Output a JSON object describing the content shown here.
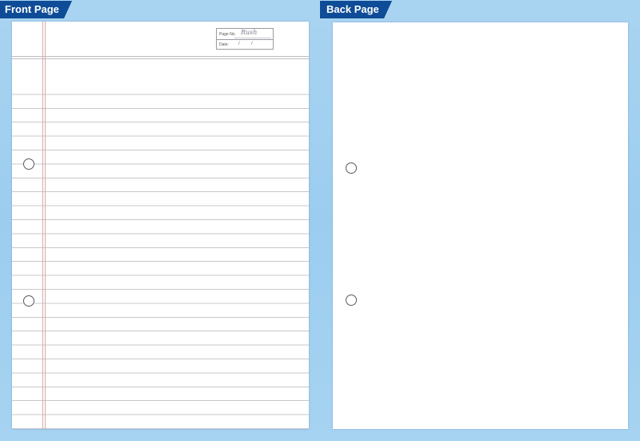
{
  "tabs": {
    "front_label": "Front Page",
    "back_label": "Back Page"
  },
  "front_page": {
    "header_box": {
      "page_no_label": "Page No.",
      "date_label": "Date:",
      "brand": "Rush",
      "date_sep1": "/",
      "date_sep2": "/"
    },
    "ruled_lines": true,
    "punch_holes": 2
  },
  "back_page": {
    "punch_holes": 2
  },
  "colors": {
    "background": "#a9d4f1",
    "tab": "#0f4c97",
    "tab_text": "#ffffff",
    "margin_line": "#d8a7a7",
    "rule_line": "#c8c8cc"
  }
}
